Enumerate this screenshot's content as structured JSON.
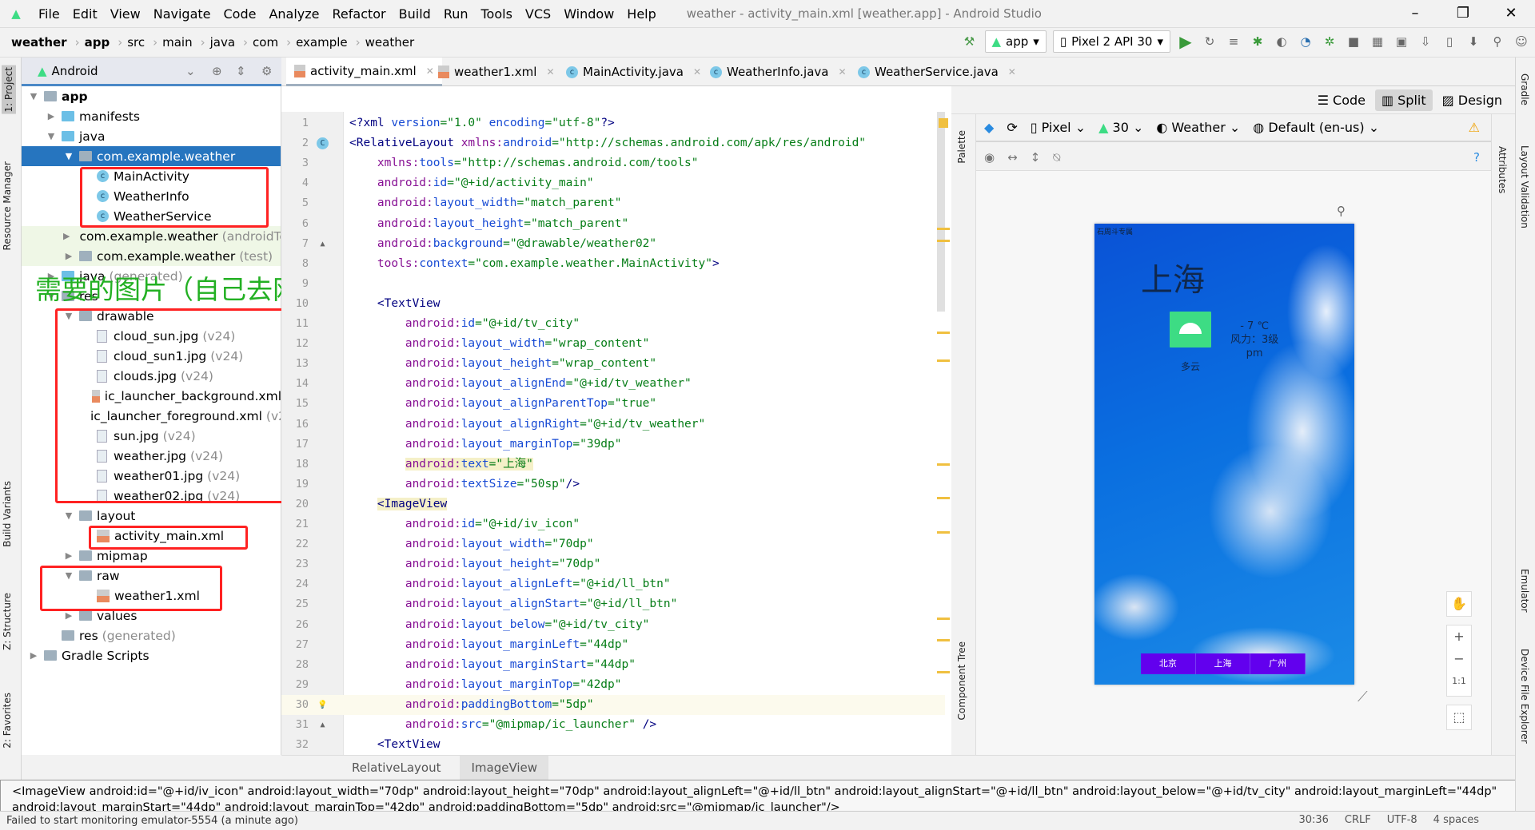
{
  "menubar": {
    "items": [
      "File",
      "Edit",
      "View",
      "Navigate",
      "Code",
      "Analyze",
      "Refactor",
      "Build",
      "Run",
      "Tools",
      "VCS",
      "Window",
      "Help"
    ],
    "title": "weather - activity_main.xml [weather.app] - Android Studio"
  },
  "navbar": {
    "breadcrumbs": [
      "weather",
      "app",
      "src",
      "main",
      "java",
      "com",
      "example",
      "weather"
    ],
    "run_config": "app",
    "device": "Pixel 2 API 30"
  },
  "project": {
    "view": "Android",
    "rows": [
      {
        "label": "app",
        "dim": "",
        "level": 0,
        "arrow": "▼",
        "icon": "module"
      },
      {
        "label": "manifests",
        "dim": "",
        "level": 1,
        "arrow": "▶",
        "icon": "folder-blue"
      },
      {
        "label": "java",
        "dim": "",
        "level": 1,
        "arrow": "▼",
        "icon": "folder-blue"
      },
      {
        "label": "com.example.weather",
        "dim": "",
        "level": 2,
        "arrow": "▼",
        "icon": "package",
        "selected": true
      },
      {
        "label": "MainActivity",
        "dim": "",
        "level": 3,
        "arrow": "",
        "icon": "class"
      },
      {
        "label": "WeatherInfo",
        "dim": "",
        "level": 3,
        "arrow": "",
        "icon": "class"
      },
      {
        "label": "WeatherService",
        "dim": "",
        "level": 3,
        "arrow": "",
        "icon": "class"
      },
      {
        "label": "com.example.weather",
        "dim": "(androidTest)",
        "level": 2,
        "arrow": "▶",
        "icon": "package",
        "test": true
      },
      {
        "label": "com.example.weather",
        "dim": "(test)",
        "level": 2,
        "arrow": "▶",
        "icon": "package",
        "test": true
      },
      {
        "label": "java",
        "dim": "(generated)",
        "level": 1,
        "arrow": "▶",
        "icon": "folder-blue"
      },
      {
        "label": "res",
        "dim": "",
        "level": 1,
        "arrow": "▼",
        "icon": "res"
      },
      {
        "label": "drawable",
        "dim": "",
        "level": 2,
        "arrow": "▼",
        "icon": "package"
      },
      {
        "label": "cloud_sun.jpg",
        "dim": "(v24)",
        "level": 3,
        "arrow": "",
        "icon": "image"
      },
      {
        "label": "cloud_sun1.jpg",
        "dim": "(v24)",
        "level": 3,
        "arrow": "",
        "icon": "image"
      },
      {
        "label": "clouds.jpg",
        "dim": "(v24)",
        "level": 3,
        "arrow": "",
        "icon": "image"
      },
      {
        "label": "ic_launcher_background.xml",
        "dim": "",
        "level": 3,
        "arrow": "",
        "icon": "xml"
      },
      {
        "label": "ic_launcher_foreground.xml",
        "dim": "(v24)",
        "level": 3,
        "arrow": "",
        "icon": "xml"
      },
      {
        "label": "sun.jpg",
        "dim": "(v24)",
        "level": 3,
        "arrow": "",
        "icon": "image"
      },
      {
        "label": "weather.jpg",
        "dim": "(v24)",
        "level": 3,
        "arrow": "",
        "icon": "image"
      },
      {
        "label": "weather01.jpg",
        "dim": "(v24)",
        "level": 3,
        "arrow": "",
        "icon": "image"
      },
      {
        "label": "weather02.jpg",
        "dim": "(v24)",
        "level": 3,
        "arrow": "",
        "icon": "image"
      },
      {
        "label": "layout",
        "dim": "",
        "level": 2,
        "arrow": "▼",
        "icon": "package"
      },
      {
        "label": "activity_main.xml",
        "dim": "",
        "level": 3,
        "arrow": "",
        "icon": "xml"
      },
      {
        "label": "mipmap",
        "dim": "",
        "level": 2,
        "arrow": "▶",
        "icon": "package"
      },
      {
        "label": "raw",
        "dim": "",
        "level": 2,
        "arrow": "▼",
        "icon": "package"
      },
      {
        "label": "weather1.xml",
        "dim": "",
        "level": 3,
        "arrow": "",
        "icon": "xml"
      },
      {
        "label": "values",
        "dim": "",
        "level": 2,
        "arrow": "▶",
        "icon": "package"
      },
      {
        "label": "res",
        "dim": "(generated)",
        "level": 1,
        "arrow": "",
        "icon": "res"
      },
      {
        "label": "Gradle Scripts",
        "dim": "",
        "level": 0,
        "arrow": "▶",
        "icon": "gradle"
      }
    ]
  },
  "annotation": "需要的图片（自己去网上找自己喜欢的图片）",
  "left_tool_tabs": [
    "1: Project",
    "Resource Manager",
    "Build Variants",
    "Z: Structure",
    "2: Favorites"
  ],
  "right_tool_tabs": [
    "Gradle",
    "Layout Validation",
    "Emulator",
    "Device File Explorer"
  ],
  "tabs": [
    {
      "label": "activity_main.xml",
      "type": "xml",
      "active": true
    },
    {
      "label": "weather1.xml",
      "type": "xml"
    },
    {
      "label": "MainActivity.java",
      "type": "class"
    },
    {
      "label": "WeatherInfo.java",
      "type": "class"
    },
    {
      "label": "WeatherService.java",
      "type": "class"
    }
  ],
  "editor": {
    "current_line": 30,
    "lines": [
      "<?xml version=\"1.0\" encoding=\"utf-8\"?>",
      "<RelativeLayout xmlns:android=\"http://schemas.android.com/apk/res/android\"",
      "    xmlns:tools=\"http://schemas.android.com/tools\"",
      "    android:id=\"@+id/activity_main\"",
      "    android:layout_width=\"match_parent\"",
      "    android:layout_height=\"match_parent\"",
      "    android:background=\"@drawable/weather02\"",
      "    tools:context=\"com.example.weather.MainActivity\">",
      "",
      "    <TextView",
      "        android:id=\"@+id/tv_city\"",
      "        android:layout_width=\"wrap_content\"",
      "        android:layout_height=\"wrap_content\"",
      "        android:layout_alignEnd=\"@+id/tv_weather\"",
      "        android:layout_alignParentTop=\"true\"",
      "        android:layout_alignRight=\"@+id/tv_weather\"",
      "        android:layout_marginTop=\"39dp\"",
      "        android:text=\"上海\"",
      "        android:textSize=\"50sp\"/>",
      "    <ImageView",
      "        android:id=\"@+id/iv_icon\"",
      "        android:layout_width=\"70dp\"",
      "        android:layout_height=\"70dp\"",
      "        android:layout_alignLeft=\"@+id/ll_btn\"",
      "        android:layout_alignStart=\"@+id/ll_btn\"",
      "        android:layout_below=\"@+id/tv_city\"",
      "        android:layout_marginLeft=\"44dp\"",
      "        android:layout_marginStart=\"44dp\"",
      "        android:layout_marginTop=\"42dp\"",
      "        android:paddingBottom=\"5dp\"",
      "        android:src=\"@mipmap/ic_launcher\" />",
      "    <TextView"
    ]
  },
  "design": {
    "modes": [
      "Code",
      "Split",
      "Design"
    ],
    "active_mode": "Split",
    "device": "Pixel",
    "api": "30",
    "theme": "Weather",
    "locale": "Default (en-us)",
    "palette_label": "Palette",
    "component_tree_label": "Component Tree",
    "attributes_label": "Attributes"
  },
  "phone": {
    "brand": "石周斗专属",
    "city": "上海",
    "condition": "多云",
    "temp": "- 7 ℃",
    "wind": "风力：3级",
    "time": "pm",
    "buttons": [
      "北京",
      "上海",
      "广州"
    ]
  },
  "breadcrumb_bottom": [
    "RelativeLayout",
    "ImageView"
  ],
  "tooltip": "<ImageView android:id=\"@+id/iv_icon\" android:layout_width=\"70dp\" android:layout_height=\"70dp\" android:layout_alignLeft=\"@+id/ll_btn\" android:layout_alignStart=\"@+id/ll_btn\" android:layout_below=\"@+id/tv_city\" android:layout_marginLeft=\"44dp\" android:layout_marginStart=\"44dp\" android:layout_marginTop=\"42dp\" android:paddingBottom=\"5dp\" android:src=\"@mipmap/ic_launcher\"/>",
  "status": {
    "message": "Failed to start monitoring emulator-5554 (a minute ago)",
    "position": "30:36",
    "line_sep": "CRLF",
    "encoding": "UTF-8",
    "indent": "4 spaces"
  },
  "colors": {
    "selection": "#2675bf",
    "accent_green": "#3ddc84",
    "button_purple": "#6200ee",
    "annotation_green": "#23b023",
    "highlight_box": "#ff2222"
  }
}
